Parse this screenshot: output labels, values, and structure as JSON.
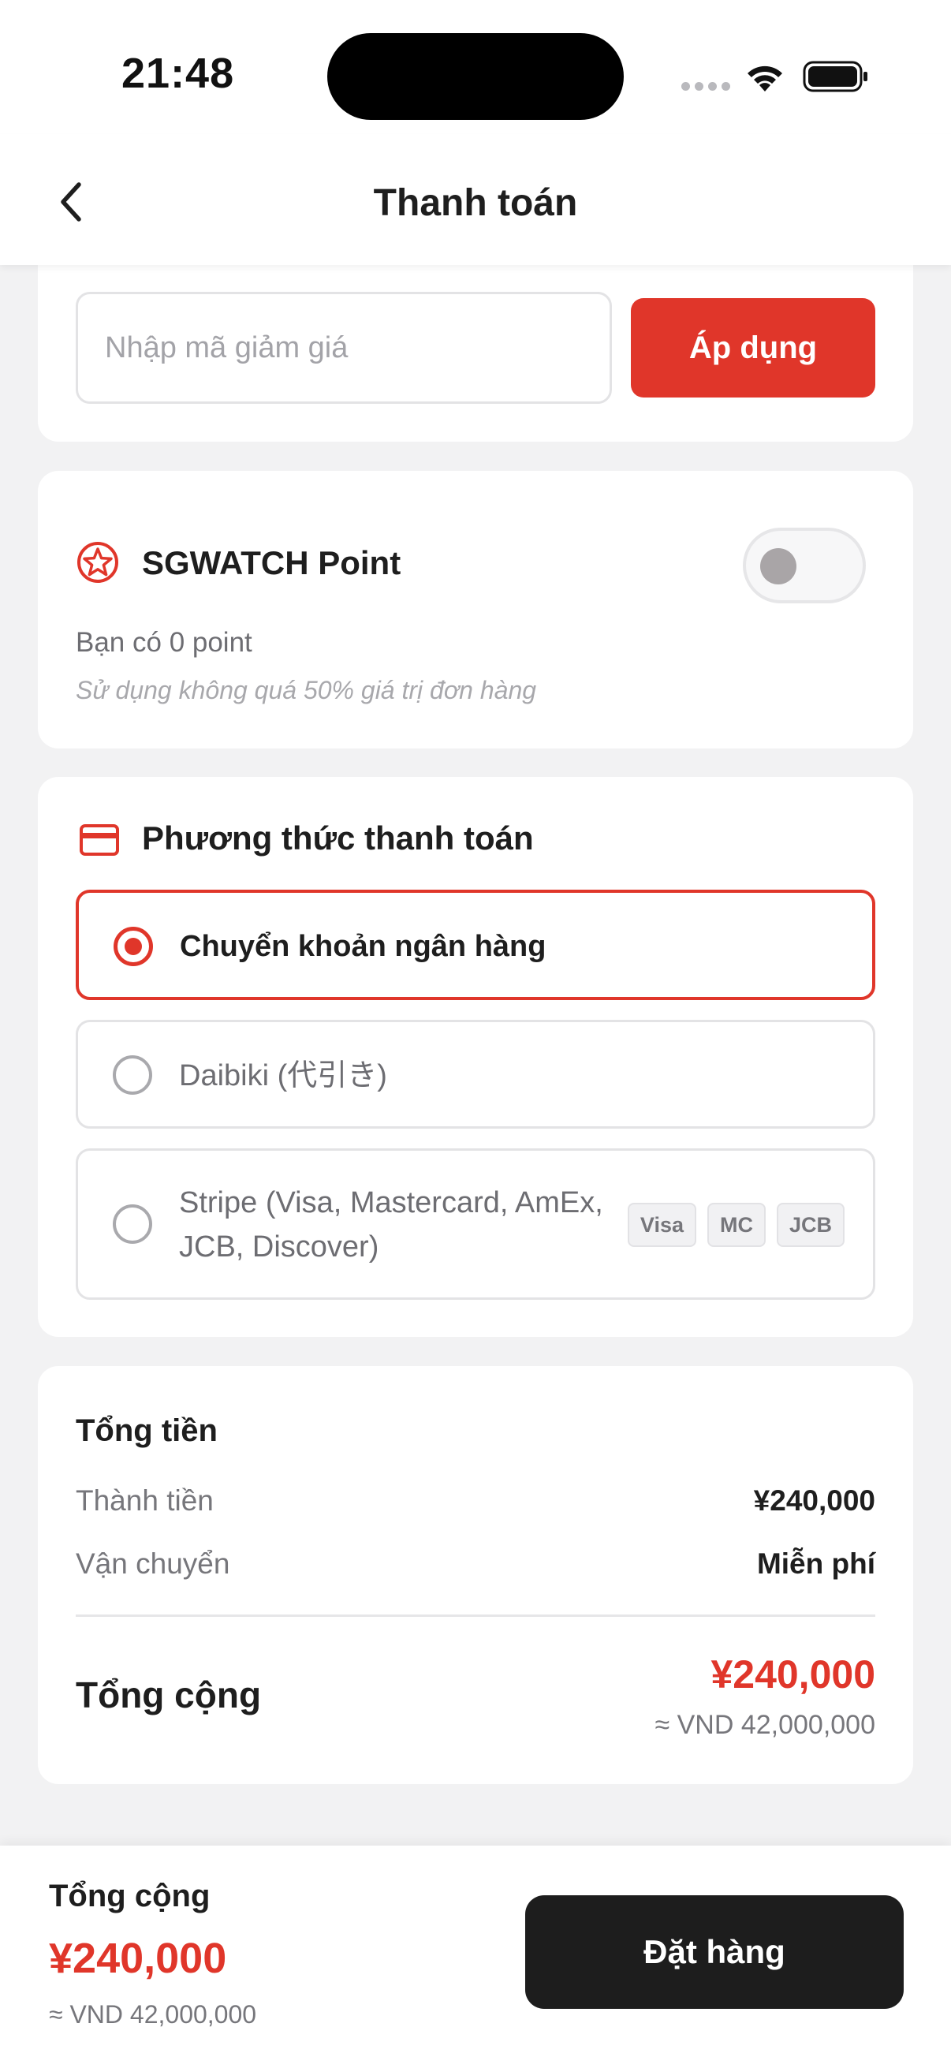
{
  "status_bar": {
    "time": "21:48"
  },
  "header": {
    "title": "Thanh toán"
  },
  "discount": {
    "placeholder": "Nhập mã giảm giá",
    "apply_label": "Áp dụng"
  },
  "points": {
    "title": "SGWATCH Point",
    "balance": "Bạn có 0 point",
    "note": "Sử dụng không quá 50% giá trị đơn hàng",
    "enabled": false
  },
  "payment": {
    "title": "Phương thức thanh toán",
    "options": [
      {
        "label": "Chuyển khoản ngân hàng",
        "selected": true
      },
      {
        "label": "Daibiki (代引き)",
        "selected": false
      },
      {
        "label": "Stripe (Visa, Mastercard, AmEx, JCB, Discover)",
        "selected": false,
        "badges": [
          "Visa",
          "MC",
          "JCB"
        ]
      }
    ]
  },
  "summary": {
    "title": "Tổng tiền",
    "rows": [
      {
        "label": "Thành tiền",
        "value": "¥240,000"
      },
      {
        "label": "Vận chuyển",
        "value": "Miễn phí"
      }
    ],
    "grand_label": "Tổng cộng",
    "grand_value": "¥240,000",
    "grand_vnd": "≈ VND 42,000,000"
  },
  "bottom_bar": {
    "label": "Tổng cộng",
    "price": "¥240,000",
    "vnd": "≈ VND 42,000,000",
    "order_label": "Đặt hàng"
  },
  "colors": {
    "accent": "#e0362a",
    "dark_button": "#1d1d1d"
  }
}
